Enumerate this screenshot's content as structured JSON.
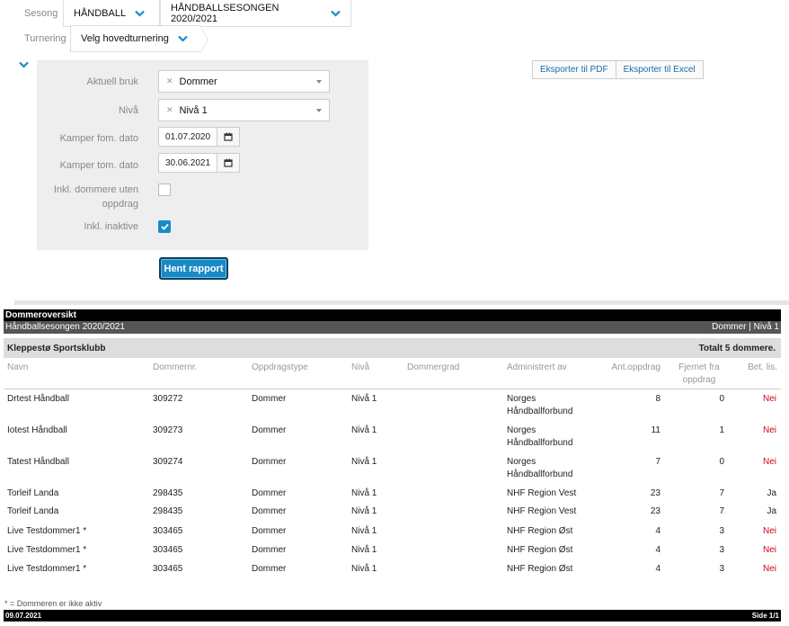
{
  "filters_top": {
    "season_label": "Sesong",
    "sport": "HÅNDBALL",
    "season": "HÅNDBALLSESONGEN 2020/2021",
    "tournament_label": "Turnering",
    "tournament": "Velg hovedturnering"
  },
  "panel": {
    "usage_label": "Aktuell bruk",
    "usage_value": "Dommer",
    "level_label": "Nivå",
    "level_value": "Nivå 1",
    "from_label": "Kamper fom. dato",
    "from_value": "01.07.2020",
    "to_label": "Kamper tom. dato",
    "to_value": "30.06.2021",
    "incl_no_assign_label": "Inkl. dommere uten oppdrag",
    "incl_no_assign_checked": false,
    "incl_inactive_label": "Inkl. inaktive",
    "incl_inactive_checked": true,
    "run_button": "Hent rapport"
  },
  "export": {
    "pdf": "Eksporter til PDF",
    "excel": "Eksporter til Excel"
  },
  "report": {
    "title": "Dommeroversikt",
    "season": "Håndballsesongen 2020/2021",
    "scope": "Dommer | Nivå 1",
    "club": "Kleppestø Sportsklubb",
    "total": "Totalt 5 dommere.",
    "headers": {
      "name": "Navn",
      "number": "Dommernr.",
      "type": "Oppdragstype",
      "level": "Nivå",
      "grade": "Dommergrad",
      "admin": "Administrert av",
      "count": "Ant.oppdrag",
      "removed": "Fjernet fra oppdrag",
      "paid": "Bet. lis."
    },
    "rows": [
      {
        "name": "Drtest Håndball",
        "number": "309272",
        "type": "Dommer",
        "level": "Nivå 1",
        "grade": "",
        "admin": "Norges Håndballforbund",
        "count": "8",
        "removed": "0",
        "paid": "Nei"
      },
      {
        "name": "Iotest Håndball",
        "number": "309273",
        "type": "Dommer",
        "level": "Nivå 1",
        "grade": "",
        "admin": "Norges Håndballforbund",
        "count": "11",
        "removed": "1",
        "paid": "Nei"
      },
      {
        "name": "Tatest Håndball",
        "number": "309274",
        "type": "Dommer",
        "level": "Nivå 1",
        "grade": "",
        "admin": "Norges Håndballforbund",
        "count": "7",
        "removed": "0",
        "paid": "Nei"
      },
      {
        "name": "Torleif Landa",
        "number": "298435",
        "type": "Dommer",
        "level": "Nivå 1",
        "grade": "",
        "admin": "NHF Region Vest",
        "count": "23",
        "removed": "7",
        "paid": "Ja"
      },
      {
        "name": "Torleif Landa",
        "number": "298435",
        "type": "Dommer",
        "level": "Nivå 1",
        "grade": "",
        "admin": "NHF Region Vest",
        "count": "23",
        "removed": "7",
        "paid": "Ja"
      },
      {
        "name": "Live Testdommer1 *",
        "number": "303465",
        "type": "Dommer",
        "level": "Nivå 1",
        "grade": "",
        "admin": "NHF Region Øst",
        "count": "4",
        "removed": "3",
        "paid": "Nei"
      },
      {
        "name": "Live Testdommer1 *",
        "number": "303465",
        "type": "Dommer",
        "level": "Nivå 1",
        "grade": "",
        "admin": "NHF Region Øst",
        "count": "4",
        "removed": "3",
        "paid": "Nei"
      },
      {
        "name": "Live Testdommer1 *",
        "number": "303465",
        "type": "Dommer",
        "level": "Nivå 1",
        "grade": "",
        "admin": "NHF Region Øst",
        "count": "4",
        "removed": "3",
        "paid": "Nei"
      }
    ],
    "footnote": "* = Dommeren er ikke aktiv",
    "date": "09.07.2021",
    "page": "Side 1/1"
  },
  "colors": {
    "accent": "#1a8ac6",
    "negative": "#d0021b"
  }
}
